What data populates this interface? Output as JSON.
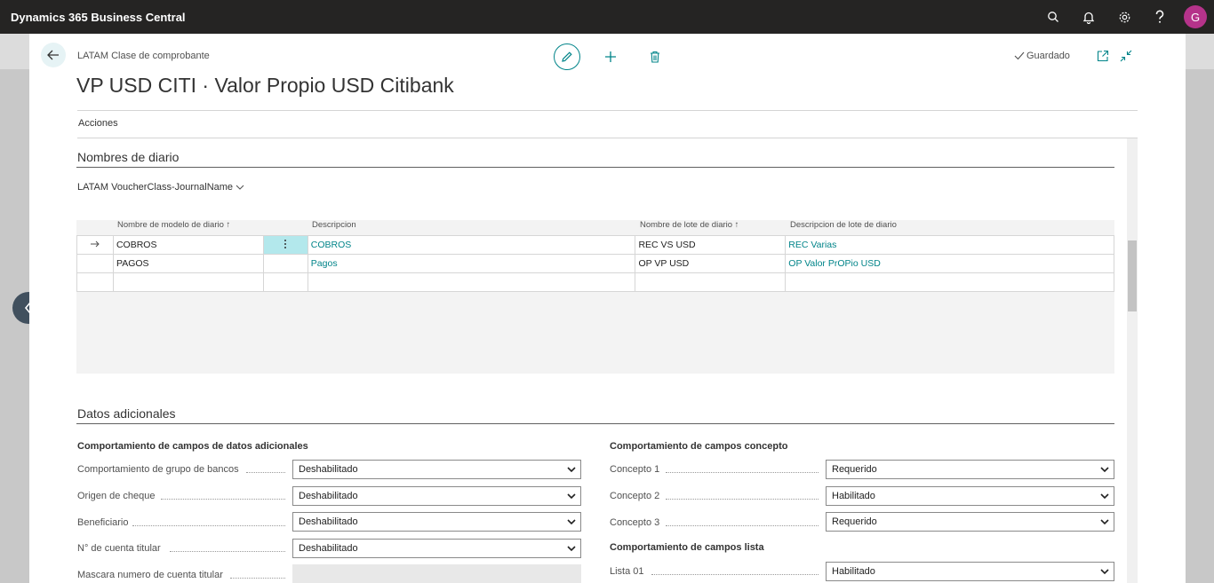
{
  "app": {
    "title": "Dynamics 365 Business Central",
    "avatar_initial": "G"
  },
  "topbar_icons": [
    "search-icon",
    "bell-icon",
    "gear-icon",
    "help-icon"
  ],
  "page": {
    "breadcrumb": "LATAM Clase de comprobante",
    "title": "VP USD CITI · Valor Propio USD Citibank",
    "saved_label": "Guardado",
    "actions_label": "Acciones"
  },
  "journal_section": {
    "title": "Nombres de diario",
    "list_name": "LATAM VoucherClass-JournalName",
    "columns": {
      "template": "Nombre de modelo de diario ↑",
      "description": "Descripcion",
      "batch": "Nombre de lote de diario ↑",
      "batch_description": "Descripcion de lote de diario"
    },
    "rows": [
      {
        "template": "COBROS",
        "description": "COBROS",
        "batch": "REC VS USD",
        "batch_description": "REC Varias"
      },
      {
        "template": "PAGOS",
        "description": "Pagos",
        "batch": "OP VP USD",
        "batch_description": "OP Valor PrOPio USD"
      }
    ]
  },
  "additional_section": {
    "title": "Datos adicionales",
    "left_group_title": "Comportamiento de campos de datos adicionales",
    "left_fields": [
      {
        "label": "Comportamiento de grupo de bancos",
        "value": "Deshabilitado"
      },
      {
        "label": "Origen de cheque",
        "value": "Deshabilitado"
      },
      {
        "label": "Beneficiario",
        "value": "Deshabilitado"
      },
      {
        "label": "N° de cuenta titular",
        "value": "Deshabilitado"
      },
      {
        "label": "Mascara numero de cuenta titular",
        "value": ""
      }
    ],
    "right_group_title": "Comportamiento de campos concepto",
    "right_fields": [
      {
        "label": "Concepto 1",
        "value": "Requerido"
      },
      {
        "label": "Concepto 2",
        "value": "Habilitado"
      },
      {
        "label": "Concepto 3",
        "value": "Requerido"
      }
    ],
    "list_group_title": "Comportamiento de campos lista",
    "list_fields": [
      {
        "label": "Lista 01",
        "value": "Habilitado"
      }
    ]
  },
  "colors": {
    "accent": "#008489",
    "topbar": "#252423",
    "avatar": "#b5338a",
    "selected_cell": "#b3e8ec"
  }
}
